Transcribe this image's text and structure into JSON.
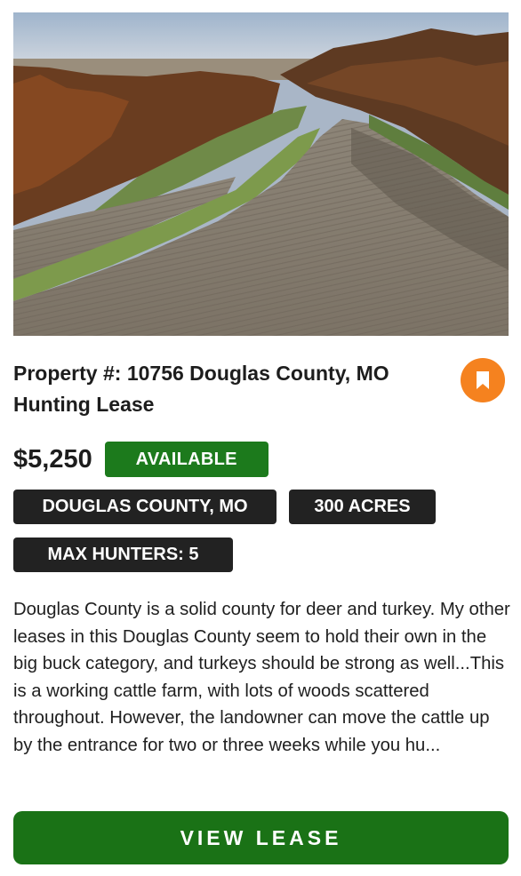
{
  "listing": {
    "photo_alt": "",
    "title": "Property #: 10756 Douglas County, MO Hunting Lease",
    "price": "$5,250",
    "status": "AVAILABLE",
    "tags": {
      "county": "DOUGLAS COUNTY, MO",
      "acres": "300 ACRES",
      "max_hunters": "MAX HUNTERS: 5"
    },
    "description": "Douglas County is a solid county for deer and turkey. My other leases in this Douglas County seem to hold their own in the big buck category, and turkeys should be strong as well...This is a working cattle farm, with lots of woods scattered throughout. However, the landowner can move the cattle up by the entrance for two or three weeks while you hu...",
    "cta_label": "VIEW LEASE"
  },
  "icons": {
    "bookmark": "bookmark-icon"
  },
  "colors": {
    "accent_green": "#1c7a1c",
    "cta_green": "#1a7216",
    "bookmark_orange": "#f5821f",
    "tag_dark": "#222222"
  }
}
